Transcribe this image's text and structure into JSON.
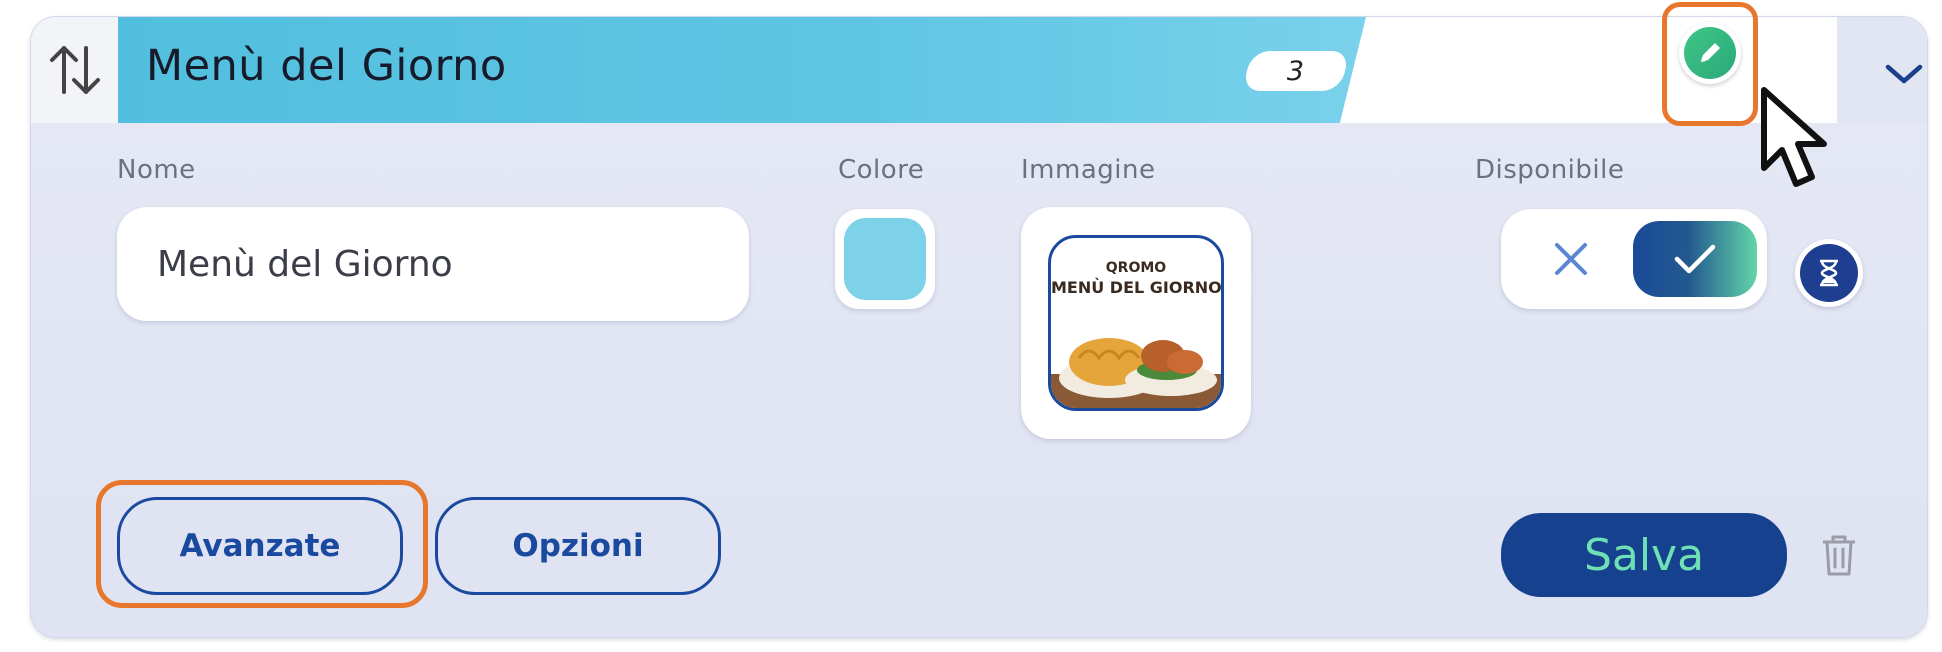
{
  "category": {
    "title": "Menù del Giorno",
    "item_count": "3",
    "color": "#7dd2ea"
  },
  "form": {
    "name_label": "Nome",
    "name_value": "Menù del Giorno",
    "color_label": "Colore",
    "image_label": "Immagine",
    "image_caption_1": "QROMO",
    "image_caption_2": "MENÙ DEL GIORNO",
    "available_label": "Disponibile",
    "available": true
  },
  "buttons": {
    "advanced": "Avanzate",
    "options": "Opzioni",
    "save": "Salva"
  },
  "icons": {
    "sort": "sort-arrows-icon",
    "edit": "pencil-icon",
    "expand": "chevron-down-icon",
    "toggle_off": "x-icon",
    "toggle_on": "check-icon",
    "timer": "hourglass-icon",
    "delete": "trash-icon",
    "cursor": "mouse-pointer-icon"
  },
  "colors": {
    "highlight": "#e8772e",
    "primary": "#16418f",
    "accent_green": "#3fc786",
    "banner": "#52bfde"
  }
}
